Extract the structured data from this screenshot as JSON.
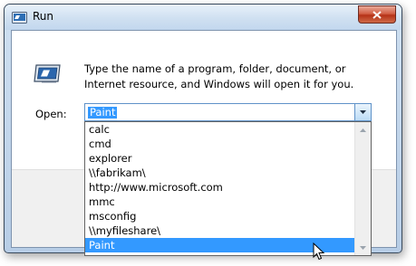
{
  "window": {
    "title": "Run",
    "close_icon": "close-icon"
  },
  "icons": {
    "title": "run-app-icon",
    "main": "run-app-icon"
  },
  "description": "Type the name of a program, folder, document, or Internet resource, and Windows will open it for you.",
  "open": {
    "label": "Open:",
    "value": "Paint"
  },
  "dropdown": {
    "items": [
      "calc",
      "cmd",
      "explorer",
      "\\\\fabrikam\\",
      "http://www.microsoft.com",
      "mmc",
      "msconfig",
      "\\\\myfileshare\\",
      "Paint"
    ],
    "selected": "Paint"
  },
  "colors": {
    "selection": "#3399ff",
    "close_button": "#c4401f",
    "frame": "#c2d7ee"
  }
}
